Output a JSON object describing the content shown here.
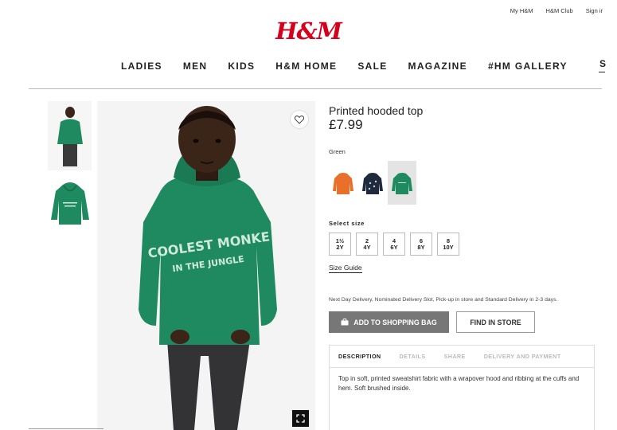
{
  "utility_links": [
    "My H&M",
    "H&M Club",
    "Sign ir"
  ],
  "brand": {
    "logo_text": "H&M",
    "color": "#d6001c"
  },
  "nav": {
    "items": [
      "LADIES",
      "MEN",
      "KIDS",
      "H&M HOME",
      "SALE",
      "MAGAZINE",
      "#HM GALLERY"
    ],
    "clipped_item": "S"
  },
  "gallery": {
    "thumbnails": [
      "model-thumbnail",
      "hoodie-thumbnail"
    ],
    "main_image": "child-model-green-hoodie",
    "hoodie_print": [
      "COOLEST MONKE",
      "IN THE JUNGLE"
    ],
    "favourite_icon": "heart-icon",
    "zoom_icon": "fullscreen-icon"
  },
  "product": {
    "title": "Printed hooded top",
    "price": "£7.99",
    "color_label": "Green",
    "swatches": [
      {
        "name": "orange",
        "color": "#e8702a"
      },
      {
        "name": "navy",
        "color": "#1f2a3c"
      },
      {
        "name": "green",
        "color": "#1f8a5f",
        "selected": true
      }
    ],
    "size_label": "Select size",
    "sizes": [
      {
        "top": "1½",
        "bottom": "2Y"
      },
      {
        "top": "2",
        "bottom": "4Y"
      },
      {
        "top": "4",
        "bottom": "6Y"
      },
      {
        "top": "6",
        "bottom": "8Y"
      },
      {
        "top": "8",
        "bottom": "10Y"
      }
    ],
    "size_guide": "Size Guide",
    "delivery_text": "Next Day Delivery, Nominated Delivery Slot, Pick-up in store and Standard Delivery in 2-3 days.",
    "add_to_bag": "ADD TO SHOPPING BAG",
    "find_in_store": "FIND IN STORE"
  },
  "info_tabs": {
    "tabs": [
      "DESCRIPTION",
      "DETAILS",
      "SHARE",
      "DELIVERY AND PAYMENT"
    ],
    "active": "DESCRIPTION",
    "description": "Top in soft, printed sweatshirt fabric with a wrapover hood and ribbing at the cuffs and hem. Soft brushed inside."
  }
}
